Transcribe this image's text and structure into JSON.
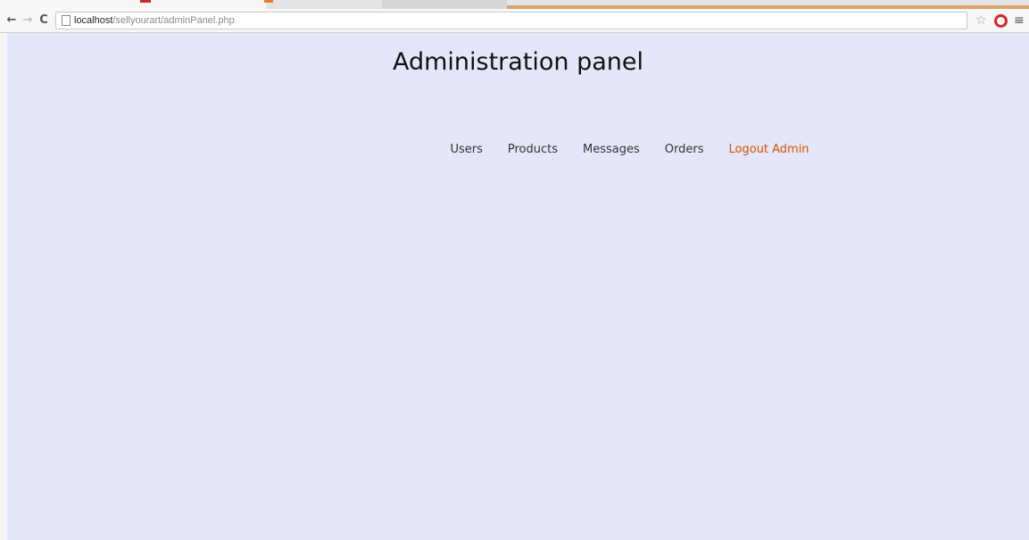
{
  "browser": {
    "url_host": "localhost",
    "url_path": "/sellyourart/adminPanel.php",
    "icons": {
      "back": "back-arrow-icon",
      "forward": "forward-arrow-icon",
      "reload": "reload-icon",
      "page": "page-icon",
      "bookmark": "star-icon",
      "opera": "opera-icon",
      "menu": "hamburger-menu-icon"
    }
  },
  "page": {
    "title": "Administration panel",
    "background_color": "#e6e6fa",
    "nav": [
      {
        "label": "Users"
      },
      {
        "label": "Products"
      },
      {
        "label": "Messages"
      },
      {
        "label": "Orders"
      },
      {
        "label": "Logout Admin",
        "color": "#d35400"
      }
    ]
  }
}
